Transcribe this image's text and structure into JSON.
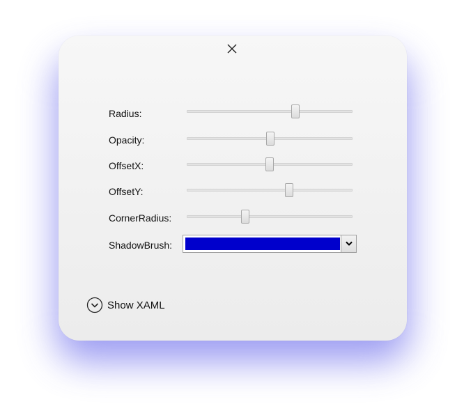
{
  "window": {
    "close_icon": "close-icon",
    "footer_icon": "chevron-down-circle-icon"
  },
  "sliders": [
    {
      "label": "Radius:",
      "value": 0.665
    },
    {
      "label": "Opacity:",
      "value": 0.505
    },
    {
      "label": "OffsetX:",
      "value": 0.5
    },
    {
      "label": "OffsetY:",
      "value": 0.625
    },
    {
      "label": "CornerRadius:",
      "value": 0.345
    }
  ],
  "shadow_brush": {
    "label": "ShadowBrush:",
    "color": "#0000CC",
    "dropdown_icon": "chevron-down-icon"
  },
  "footer": {
    "show_xaml_label": "Show XAML"
  },
  "colors": {
    "glow": "#8c8cf0",
    "card_background": "#f2f2f2"
  }
}
